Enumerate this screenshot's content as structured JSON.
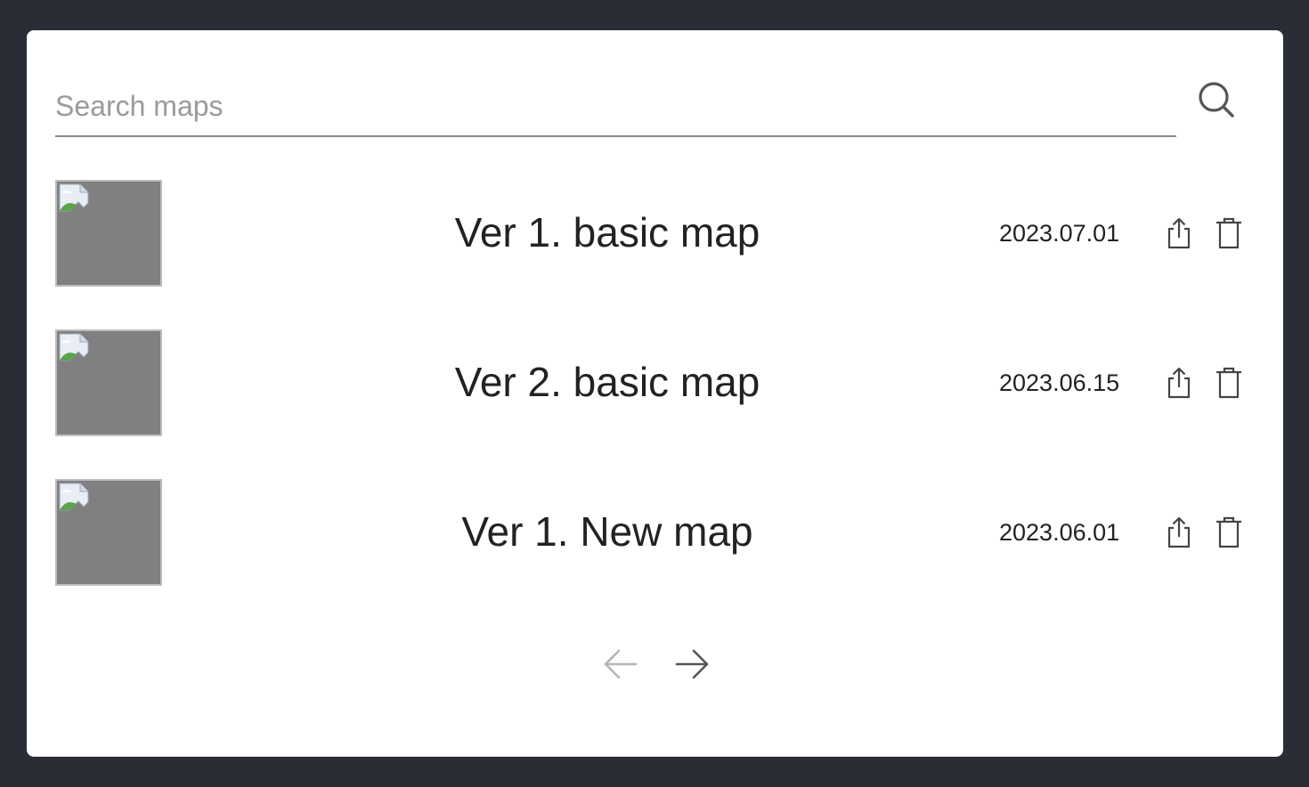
{
  "search": {
    "placeholder": "Search maps",
    "value": "",
    "icon": "search-icon"
  },
  "maps": [
    {
      "title": "Ver 1. basic map",
      "date": "2023.07.01"
    },
    {
      "title": "Ver 2. basic map",
      "date": "2023.06.15"
    },
    {
      "title": "Ver 1. New map",
      "date": "2023.06.01"
    }
  ],
  "pagination": {
    "prev_icon": "arrow-left-icon",
    "next_icon": "arrow-right-icon",
    "prev_enabled": false,
    "next_enabled": true
  },
  "colors": {
    "background": "#2a2d35",
    "panel": "#ffffff",
    "thumbnail_placeholder": "#808080",
    "text": "#222222",
    "muted": "#9a9a9a"
  }
}
